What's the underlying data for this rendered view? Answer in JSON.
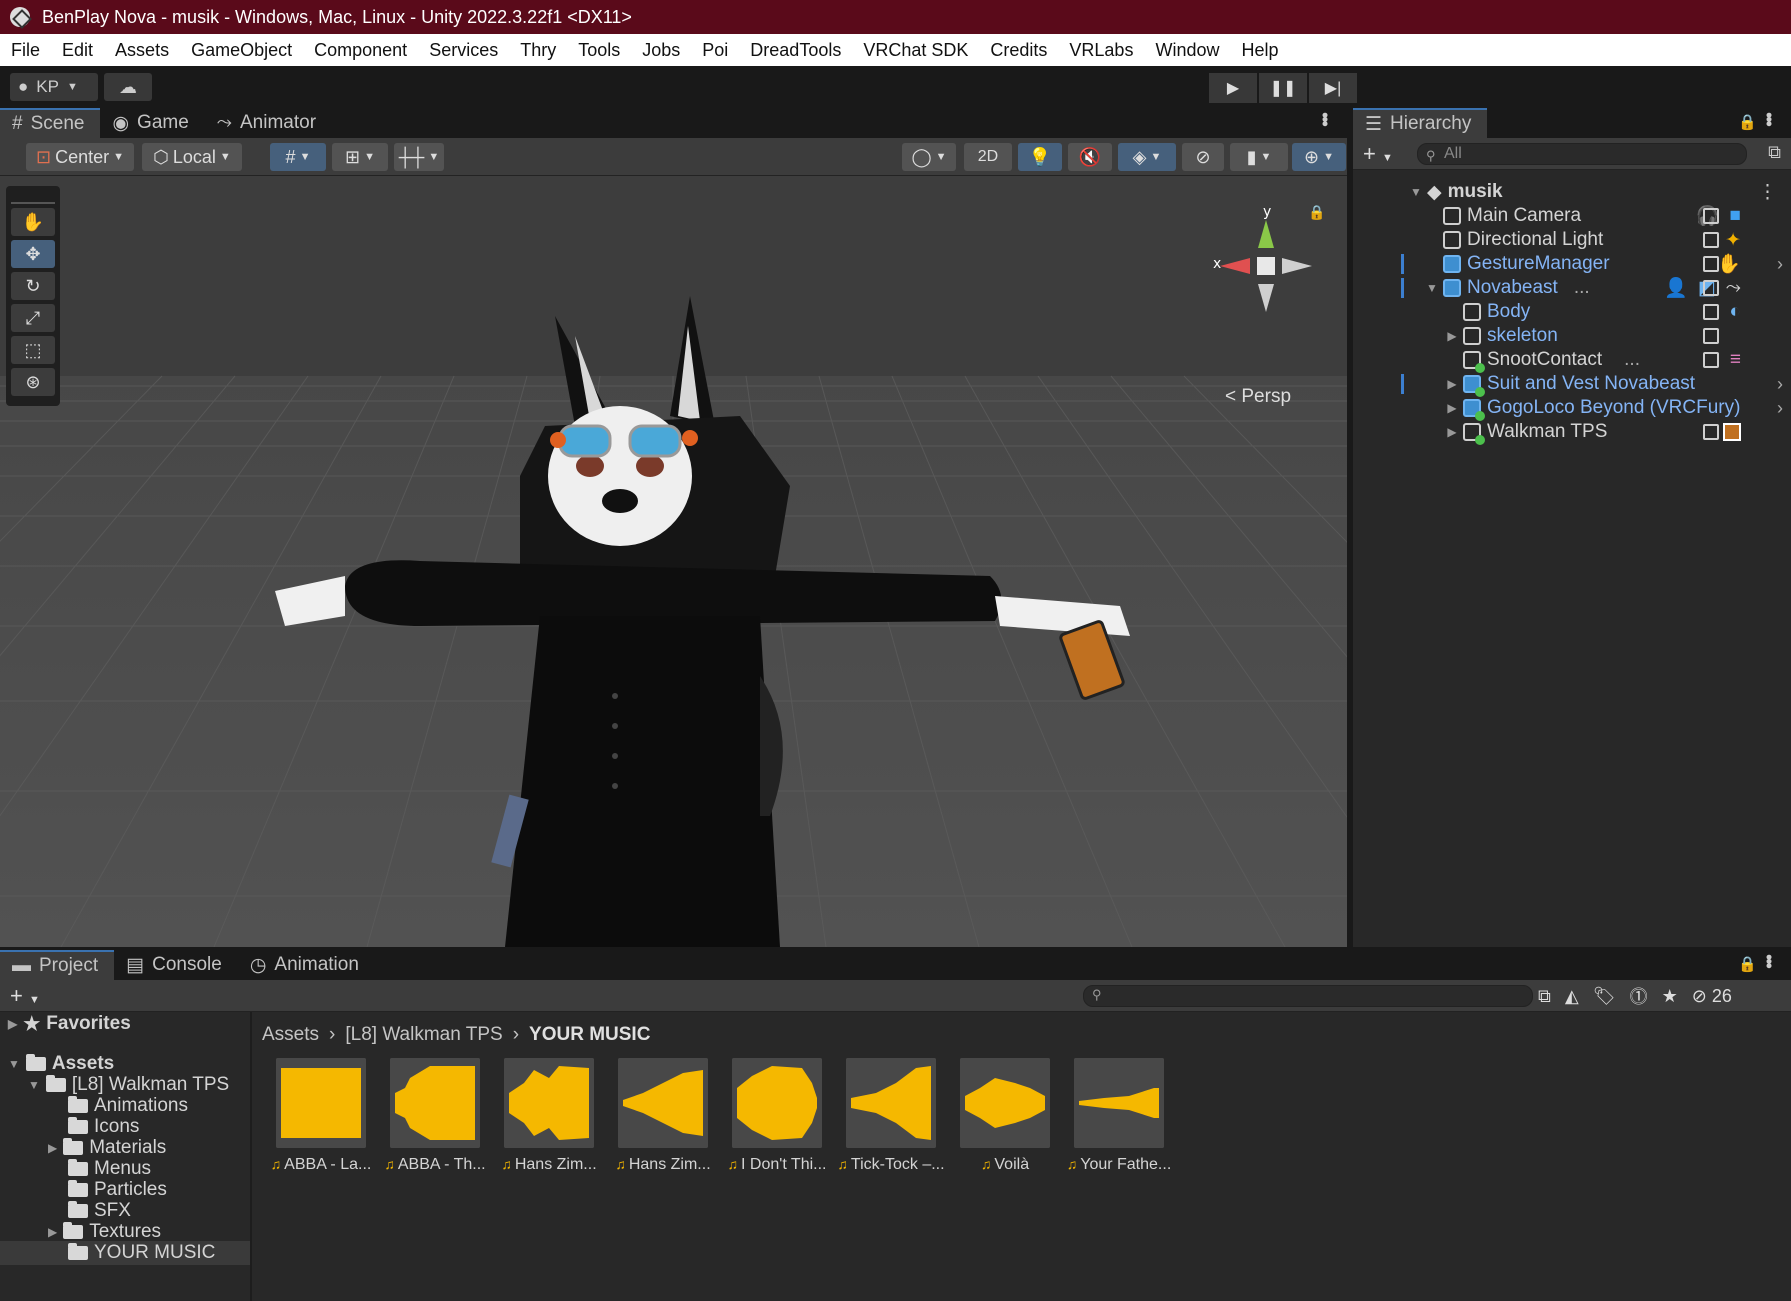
{
  "window": {
    "title": "BenPlay Nova - musik - Windows, Mac, Linux - Unity 2022.3.22f1 <DX11>"
  },
  "menu": [
    "File",
    "Edit",
    "Assets",
    "GameObject",
    "Component",
    "Services",
    "Thry",
    "Tools",
    "Jobs",
    "Poi",
    "DreadTools",
    "VRChat SDK",
    "Credits",
    "VRLabs",
    "Window",
    "Help"
  ],
  "toolbar": {
    "account": "KP"
  },
  "scene_panel": {
    "tabs": [
      "Scene",
      "Game",
      "Animator"
    ],
    "pivot_mode": "Center",
    "pivot_rotation": "Local",
    "mode_2d": "2D",
    "persp_label": "< Persp",
    "axis_y": "y",
    "axis_x": "x"
  },
  "hierarchy": {
    "tab": "Hierarchy",
    "search_placeholder": "All",
    "scene_name": "musik",
    "items": [
      {
        "label": "Main Camera"
      },
      {
        "label": "Directional Light"
      },
      {
        "label": "GestureManager"
      },
      {
        "label": "Novabeast",
        "suffix": "..."
      },
      {
        "label": "Body"
      },
      {
        "label": "skeleton"
      },
      {
        "label": "SnootContact",
        "suffix": "..."
      },
      {
        "label": "Suit and Vest Novabeast"
      },
      {
        "label": "GogoLoco Beyond (VRCFury)"
      },
      {
        "label": "Walkman TPS"
      }
    ]
  },
  "project": {
    "tabs": [
      "Project",
      "Console",
      "Animation"
    ],
    "hidden_count": "26",
    "favorites": "Favorites",
    "assets_root": "Assets",
    "package_folder": "[L8] Walkman TPS",
    "folders": [
      "Animations",
      "Icons",
      "Materials",
      "Menus",
      "Particles",
      "SFX",
      "Textures",
      "YOUR MUSIC"
    ],
    "breadcrumb": [
      "Assets",
      "[L8] Walkman TPS",
      "YOUR MUSIC"
    ],
    "assets": [
      {
        "label": "ABBA - La..."
      },
      {
        "label": "ABBA - Th..."
      },
      {
        "label": "Hans Zim..."
      },
      {
        "label": "Hans Zim..."
      },
      {
        "label": "I Don't Thi..."
      },
      {
        "label": "Tick-Tock –..."
      },
      {
        "label": "Voilà"
      },
      {
        "label": "Your Fathe..."
      }
    ]
  },
  "colors": {
    "title_bar": "#5a0a1a",
    "accent_blue": "#84b4f5",
    "waveform": "#f5b800"
  }
}
